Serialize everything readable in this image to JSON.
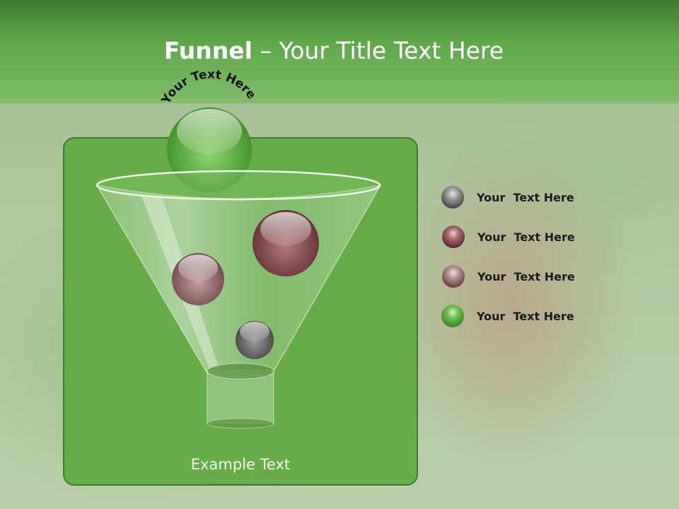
{
  "slide": {
    "title_bold": "Funnel",
    "title_rest": " – Your Title Text Here",
    "arc_text": "Your Text Here",
    "caption": "Example Text"
  },
  "legend": [
    {
      "label": "Your  Text Here",
      "color": "#6a6a6a"
    },
    {
      "label": "Your  Text Here",
      "color": "#8a4a4e"
    },
    {
      "label": "Your  Text Here",
      "color": "#94696c"
    },
    {
      "label": "Your  Text Here",
      "color": "#55a93e"
    }
  ],
  "colors": {
    "header": "#5fa74b",
    "panel": "#66ad4a",
    "panel_border": "#3f7c2f"
  }
}
